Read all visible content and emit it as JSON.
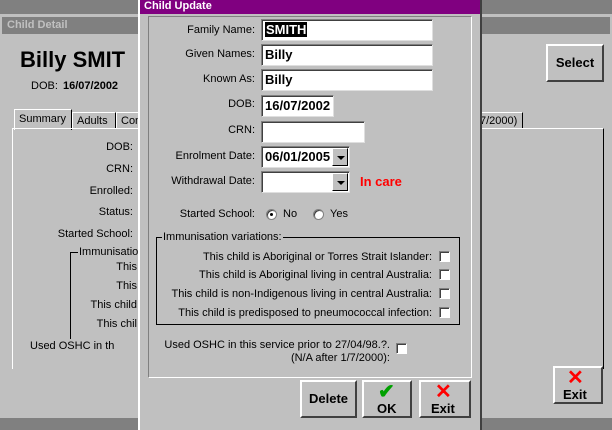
{
  "back": {
    "title": "Child Detail",
    "name": "Billy SMIT",
    "dob_label": "DOB:",
    "dob_value": "16/07/2002",
    "select_label": "Select",
    "tabs": [
      "Summary",
      "Adults",
      "Con",
      "7/2000)"
    ],
    "summary_labels": [
      "DOB:",
      "CRN:",
      "Enrolled:",
      "Status:",
      "Started School:"
    ],
    "immunisation_label": "Immunisation",
    "imm_items": [
      "This",
      "This",
      "This child",
      "This chil"
    ],
    "oshc_label": "Used OSHC in th",
    "exit_label": "Exit"
  },
  "dialog": {
    "title": "Child Update",
    "labels": {
      "family_name": "Family Name:",
      "given_names": "Given Names:",
      "known_as": "Known As:",
      "dob": "DOB:",
      "crn": "CRN:",
      "enrolment_date": "Enrolment Date:",
      "withdrawal_date": "Withdrawal Date:",
      "started_school": "Started School:"
    },
    "values": {
      "family_name": "SMITH",
      "given_names": "Billy",
      "known_as": "Billy",
      "dob": "16/07/2002",
      "crn": "",
      "enrolment_date": "06/01/2005",
      "withdrawal_date": ""
    },
    "status_text": "In care",
    "status_color": "#ff0000",
    "started_school_options": {
      "no": "No",
      "yes": "Yes",
      "selected": "No"
    },
    "immunisation_group": "Immunisation variations:",
    "immunisation_items": [
      "This child is Aboriginal or Torres Strait Islander:",
      "This child is Aboriginal living in central Australia:",
      "This child is non-Indigenous living in central Australia:",
      "This child is predisposed to pneumococcal infection:"
    ],
    "oshc_line1": "Used OSHC in this service prior to 27/04/98.?.",
    "oshc_line2": "(N/A after 1/7/2000):",
    "buttons": {
      "delete": "Delete",
      "ok": "OK",
      "exit": "Exit"
    }
  },
  "colors": {
    "title_bar": "#800080",
    "back_title_bar": "#808080",
    "ok_check": "#00a000",
    "exit_x": "#ff0000"
  }
}
